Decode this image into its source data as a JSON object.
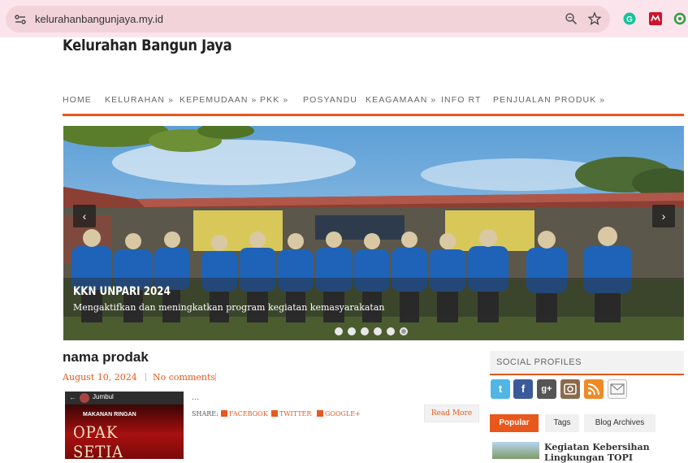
{
  "browser": {
    "url": "kelurahanbangunjaya.my.id"
  },
  "site": {
    "title": "Kelurahan Bangun Jaya"
  },
  "nav": {
    "items": [
      {
        "label": "HOME"
      },
      {
        "label": "KELURAHAN »"
      },
      {
        "label": "KEPEMUDAAN »"
      },
      {
        "label": "PKK »"
      },
      {
        "label": "POSYANDU"
      },
      {
        "label": "KEAGAMAAN »"
      },
      {
        "label": "INFO RT"
      },
      {
        "label": "PENJUALAN PRODUK »"
      }
    ]
  },
  "slider": {
    "title": "KKN UNPARI 2024",
    "description": "Mengaktifkan dan meningkatkan program kegiatan kemasyarakatan",
    "prev_label": "‹",
    "next_label": "›",
    "dot_count": 6,
    "active_dot": 6
  },
  "post": {
    "title": "nama prodak",
    "date": "August 10, 2024",
    "separator": "|",
    "comments": "No comments",
    "excerpt": "...",
    "thumb": {
      "back": "←",
      "name": "Jumbul",
      "tag": "MAKANAN RINGAN",
      "big": "OPAK SETIA"
    },
    "share_label": "SHARE:",
    "share_facebook": "FACEBOOK",
    "share_twitter": "TWITTER",
    "share_google": "GOOGLE+",
    "read_more": "Read More"
  },
  "sidebar": {
    "social_heading": "SOCIAL PROFILES",
    "social_icons": [
      "twitter-icon",
      "facebook-icon",
      "google-plus-icon",
      "instagram-icon",
      "rss-icon",
      "email-icon"
    ],
    "tabs": [
      {
        "label": "Popular"
      },
      {
        "label": "Tags"
      },
      {
        "label": "Blog Archives"
      }
    ],
    "popular_post": "Kegiatan Kebersihan Lingkungan TOPI"
  },
  "colors": {
    "accent": "#e8581c",
    "browser_bar": "#fce4ec"
  }
}
